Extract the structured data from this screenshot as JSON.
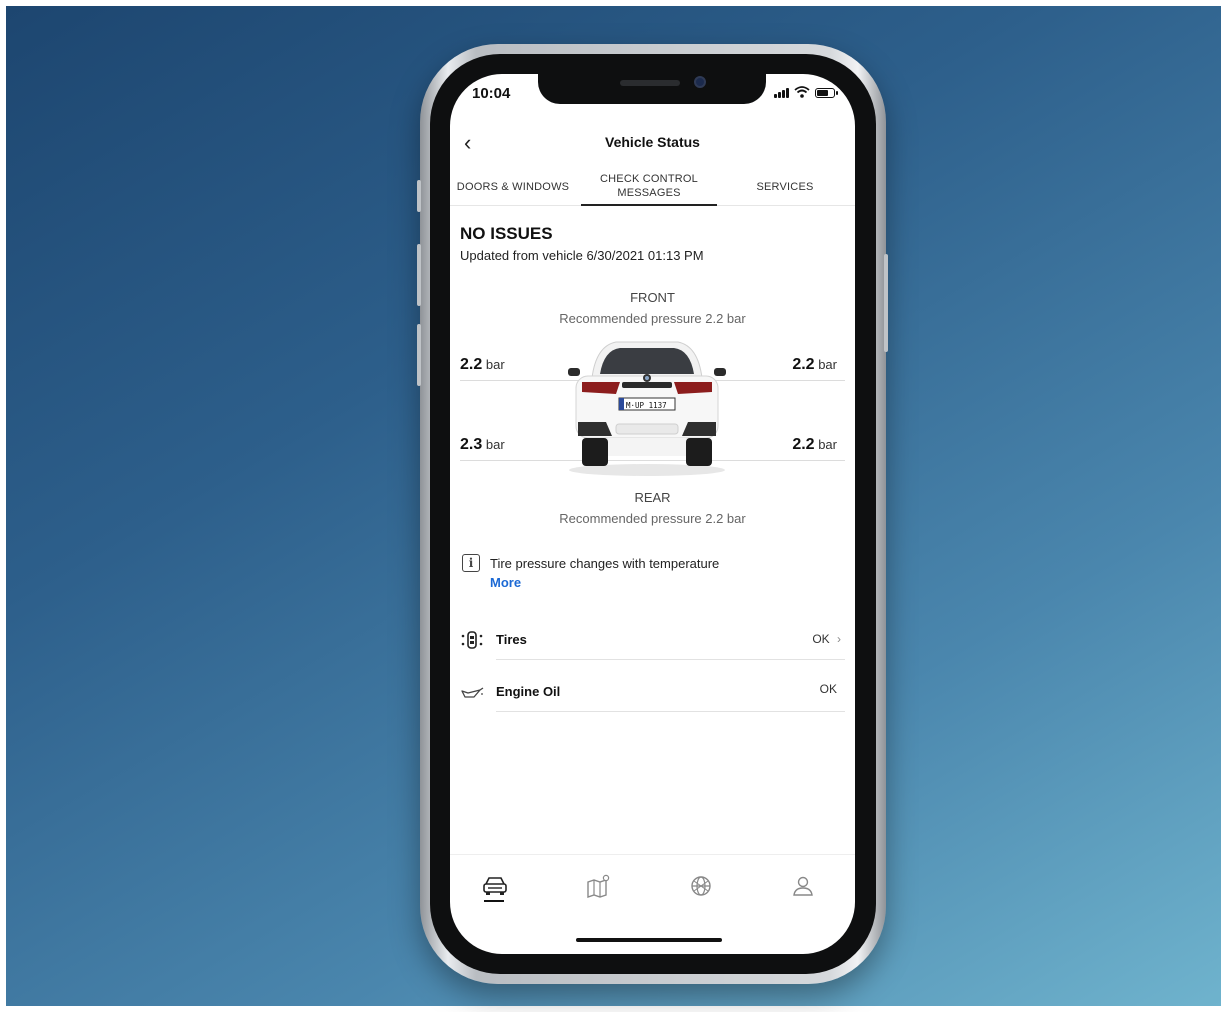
{
  "status_bar": {
    "time": "10:04"
  },
  "header": {
    "back_icon": "chevron-left-icon",
    "title": "Vehicle Status"
  },
  "tabs": [
    {
      "label": "DOORS & WINDOWS",
      "active": false
    },
    {
      "label": "CHECK CONTROL MESSAGES",
      "active": true
    },
    {
      "label": "SERVICES",
      "active": false
    }
  ],
  "summary": {
    "headline": "NO ISSUES",
    "updated": "Updated from vehicle 6/30/2021 01:13 PM"
  },
  "tire_pressure": {
    "front_label": "FRONT",
    "front_recommended": "Recommended pressure 2.2 bar",
    "rear_label": "REAR",
    "rear_recommended": "Recommended pressure 2.2 bar",
    "front_left": {
      "value": "2.2",
      "unit": "bar"
    },
    "front_right": {
      "value": "2.2",
      "unit": "bar"
    },
    "rear_left": {
      "value": "2.3",
      "unit": "bar"
    },
    "rear_right": {
      "value": "2.2",
      "unit": "bar"
    },
    "plate": "M·UP 1137"
  },
  "info": {
    "text": "Tire pressure changes with temperature",
    "link": "More"
  },
  "check_items": [
    {
      "icon": "tire-pressure-icon",
      "label": "Tires",
      "status": "OK"
    },
    {
      "icon": "engine-oil-icon",
      "label": "Engine Oil",
      "status": "OK"
    }
  ],
  "bottom_nav": [
    {
      "icon": "car-icon",
      "active": true
    },
    {
      "icon": "map-icon",
      "active": false
    },
    {
      "icon": "globe-icon",
      "active": false
    },
    {
      "icon": "profile-icon",
      "active": false
    }
  ],
  "colors": {
    "link": "#1c69d4",
    "background_start": "#1d4670",
    "background_end": "#6fb3cd"
  }
}
